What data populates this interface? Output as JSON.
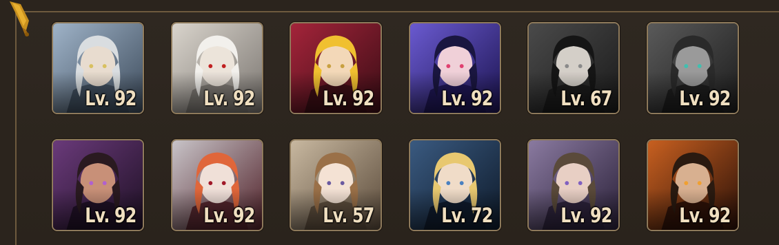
{
  "roster": {
    "characters": [
      {
        "level": "Lv. 92",
        "palette": {
          "bg1": "#9fb3c8",
          "bg2": "#3c4a5a",
          "hair": "#d9dde0",
          "skin": "#e8dccf",
          "accent": "#d8c060"
        }
      },
      {
        "level": "Lv. 92",
        "palette": {
          "bg1": "#d9d4cc",
          "bg2": "#7a7570",
          "hair": "#f2f0ec",
          "skin": "#ece4da",
          "accent": "#c02020"
        }
      },
      {
        "level": "Lv. 92",
        "palette": {
          "bg1": "#a4243a",
          "bg2": "#3a0d15",
          "hair": "#f0c030",
          "skin": "#f3d8b8",
          "accent": "#c8a040"
        }
      },
      {
        "level": "Lv. 92",
        "palette": {
          "bg1": "#6a5ad0",
          "bg2": "#1c1450",
          "hair": "#1a1640",
          "skin": "#f0d0d8",
          "accent": "#e04070"
        }
      },
      {
        "level": "Lv. 67",
        "palette": {
          "bg1": "#4a4a4a",
          "bg2": "#1a1a1a",
          "hair": "#151515",
          "skin": "#d4cfc8",
          "accent": "#8a8a8a"
        }
      },
      {
        "level": "Lv. 92",
        "palette": {
          "bg1": "#5a5a5a",
          "bg2": "#1c1c1c",
          "hair": "#2a2a2a",
          "skin": "#9a9a9a",
          "accent": "#40c0b0"
        }
      },
      {
        "level": "Lv. 92",
        "palette": {
          "bg1": "#6a3a7a",
          "bg2": "#1e1024",
          "hair": "#2a1a20",
          "skin": "#c89078",
          "accent": "#b060d0"
        }
      },
      {
        "level": "Lv. 92",
        "palette": {
          "bg1": "#c8c4c8",
          "bg2": "#502028",
          "hair": "#e0663a",
          "skin": "#f0e0d8",
          "accent": "#a01828"
        }
      },
      {
        "level": "Lv. 57",
        "palette": {
          "bg1": "#c8b8a0",
          "bg2": "#5a4a3a",
          "hair": "#9a7048",
          "skin": "#f4e2d4",
          "accent": "#6a5aa0"
        }
      },
      {
        "level": "Lv. 72",
        "palette": {
          "bg1": "#3a5a80",
          "bg2": "#0e1a2a",
          "hair": "#e8c870",
          "skin": "#f0dcc8",
          "accent": "#4a80c0"
        }
      },
      {
        "level": "Lv. 92",
        "palette": {
          "bg1": "#8a7aa0",
          "bg2": "#2a2038",
          "hair": "#5a4a3a",
          "skin": "#e8cfc4",
          "accent": "#8060c0"
        }
      },
      {
        "level": "Lv. 92",
        "palette": {
          "bg1": "#c86020",
          "bg2": "#2a1008",
          "hair": "#2a1a10",
          "skin": "#d8b090",
          "accent": "#f0a030"
        }
      }
    ]
  }
}
